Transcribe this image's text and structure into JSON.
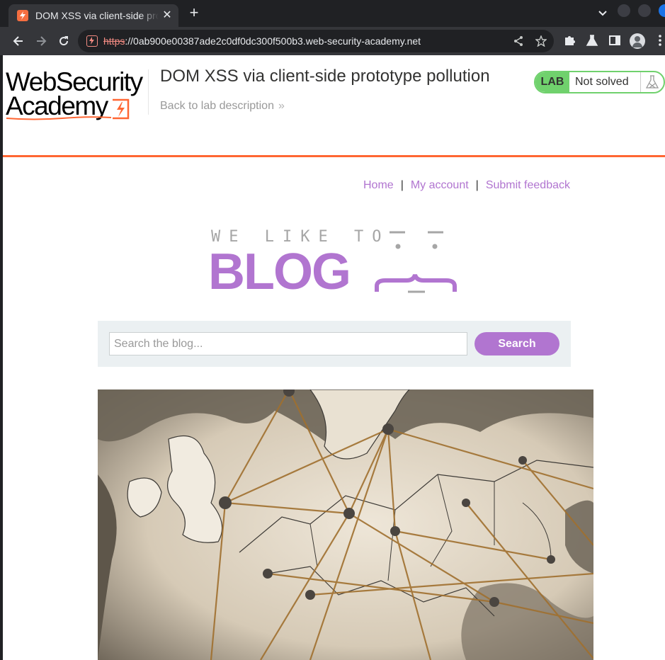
{
  "browser": {
    "tab_title": "DOM XSS via client-side prototype pollution",
    "tab_close": "✕",
    "new_tab": "+",
    "url_scheme": "https",
    "url_rest": "://0ab900e00387ade2c0df0dc300f500b3.web-security-academy.net"
  },
  "academy": {
    "logo_line1": "WebSecurity",
    "logo_line2": "Academy",
    "lab_title": "DOM XSS via client-side prototype pollution",
    "back_link": "Back to lab description",
    "back_chevrons": "»",
    "lab_badge": "LAB",
    "lab_status": "Not solved"
  },
  "colors": {
    "accent_orange": "#ff6633",
    "lab_green": "#70d16d",
    "blog_purple": "#b175d0"
  },
  "blog": {
    "nav": [
      {
        "label": "Home"
      },
      {
        "label": "My account"
      },
      {
        "label": "Submit feedback"
      }
    ],
    "nav_separator": "|",
    "logo_top": "WE LIKE TO",
    "logo_word": "BLOG",
    "search": {
      "placeholder": "Search the blog...",
      "button": "Search"
    }
  },
  "icons": {
    "favicon": "lightning-bolt-icon",
    "back": "arrow-left-icon",
    "forward": "arrow-right-icon",
    "reload": "reload-icon",
    "share": "share-icon",
    "bookmark": "star-icon",
    "extensions": "puzzle-icon",
    "labs": "flask-icon",
    "sidepanel": "sidepanel-icon",
    "profile": "profile-icon",
    "menu": "kebab-menu-icon"
  }
}
